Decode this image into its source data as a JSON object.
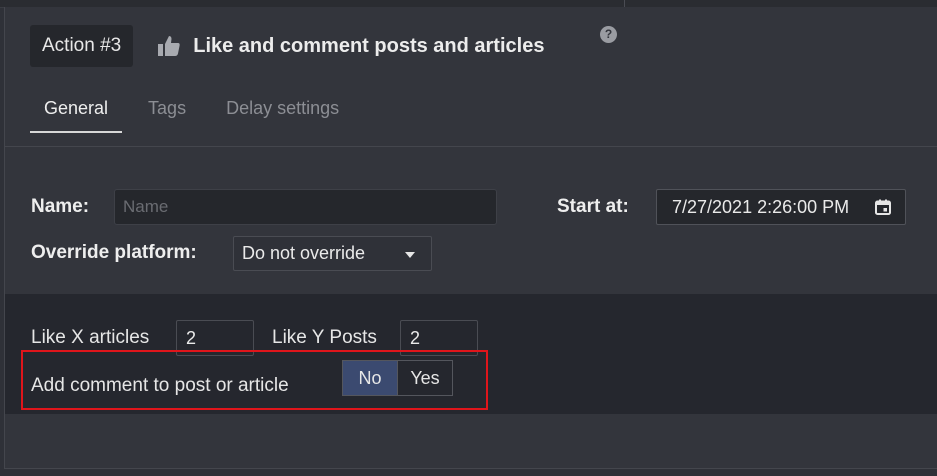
{
  "header": {
    "action_badge": "Action #3",
    "title": "Like and comment posts and articles",
    "help_glyph": "?"
  },
  "tabs": [
    {
      "label": "General",
      "active": true
    },
    {
      "label": "Tags",
      "active": false
    },
    {
      "label": "Delay settings",
      "active": false
    }
  ],
  "form": {
    "name_label": "Name:",
    "name_placeholder": "Name",
    "name_value": "",
    "start_label": "Start at:",
    "start_value": "7/27/2021 2:26:00 PM",
    "override_label": "Override platform:",
    "override_value": "Do not override"
  },
  "settings": {
    "like_articles_label": "Like X articles",
    "like_articles_value": "2",
    "like_posts_label": "Like Y Posts",
    "like_posts_value": "2",
    "comment_label": "Add comment to post or article",
    "toggle_no": "No",
    "toggle_yes": "Yes",
    "toggle_selected": "No"
  },
  "icons": {
    "thumb": "thumbs-up-icon",
    "help": "help-icon",
    "calendar": "calendar-icon",
    "dropdown": "chevron-down-icon"
  },
  "colors": {
    "toggle_active": "#3b4a70",
    "highlight": "#e0151b"
  }
}
